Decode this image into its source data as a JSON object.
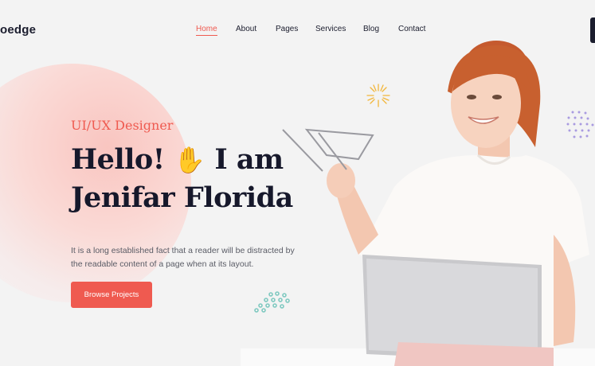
{
  "brand": {
    "logo_text": "oedge"
  },
  "nav": {
    "items": [
      {
        "label": "Home",
        "active": true
      },
      {
        "label": "About",
        "active": false
      },
      {
        "label": "Pages",
        "active": false
      },
      {
        "label": "Services",
        "active": false
      },
      {
        "label": "Blog",
        "active": false
      },
      {
        "label": "Contact",
        "active": false
      }
    ]
  },
  "hero": {
    "subtitle": "UI/UX Designer",
    "headline_line1_start": "Hello!",
    "wave_emoji": "✋",
    "headline_line1_end": "I am",
    "headline_line2": "Jenifar Florida",
    "description": "It is a long established fact that a reader will be distracted by the readable content of a page when at its layout.",
    "button_label": "Browse Projects"
  },
  "colors": {
    "accent": "#ef5a50",
    "text_dark": "#16182b",
    "background": "#f3f3f3",
    "blob": "#f9c5c0",
    "burst": "#f2b63a",
    "purple_dots": "#a99be0",
    "teal_dots": "#7fc9c0"
  },
  "icons": {
    "burst": "sunburst-icon",
    "purple_dots": "dot-pattern-icon",
    "teal_dots": "dot-pattern-icon"
  }
}
